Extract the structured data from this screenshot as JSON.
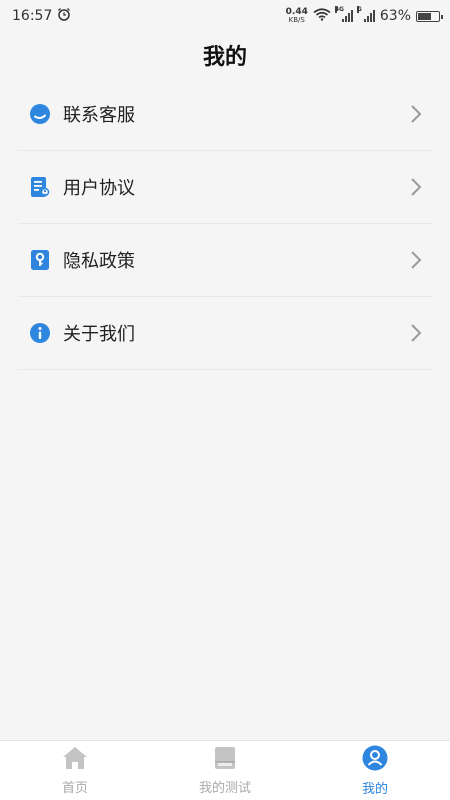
{
  "status_bar": {
    "time": "16:57",
    "net_speed_value": "0.44",
    "net_speed_unit": "KB/S",
    "network_4g": "4G",
    "network_g": "G",
    "battery": "63%"
  },
  "header": {
    "title": "我的"
  },
  "menu": {
    "items": [
      {
        "label": "联系客服",
        "icon": "customer-service-icon"
      },
      {
        "label": "用户协议",
        "icon": "agreement-document-icon"
      },
      {
        "label": "隐私政策",
        "icon": "privacy-key-icon"
      },
      {
        "label": "关于我们",
        "icon": "info-icon"
      }
    ]
  },
  "bottom_nav": {
    "items": [
      {
        "label": "首页",
        "icon": "home-icon",
        "active": false
      },
      {
        "label": "我的测试",
        "icon": "book-icon",
        "active": false
      },
      {
        "label": "我的",
        "icon": "user-icon",
        "active": true
      }
    ]
  },
  "colors": {
    "accent": "#2e86de",
    "inactive": "#aaaaaa",
    "background": "#f5f5f5"
  }
}
